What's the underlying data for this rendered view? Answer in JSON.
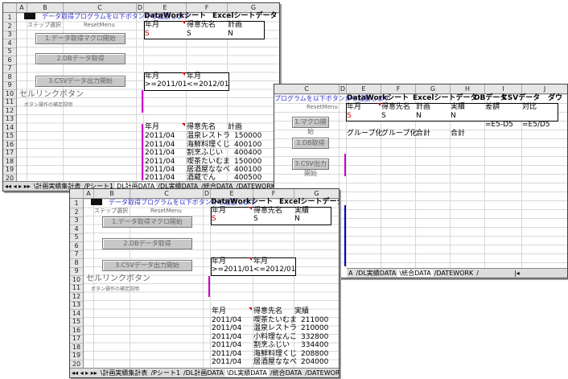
{
  "win1": {
    "cols": [
      "A",
      "B",
      "C",
      "D",
      "E",
      "F",
      "G"
    ],
    "rows": [
      "1",
      "2",
      "3",
      "4",
      "5",
      "6",
      "7",
      "8",
      "9",
      "10",
      "11",
      "12",
      "13",
      "14",
      "15",
      "16",
      "17",
      "18",
      "19",
      "20"
    ],
    "title_blue": "データ取得プログラムを以下ボタンから起動します",
    "sheet_label": "DataWorkシート",
    "sheet_label2": "Excelシートデータ",
    "subtitle_a": "ステップ選択",
    "subtitle_b": "ResetMenu",
    "btn1": "1.データ取得マクロ開始",
    "btn2": "2.DBデータ取得",
    "btn3": "3.CSVデータ出力開始",
    "cell_link": "セルリンクボタン",
    "cell_link_sub": "ボタン操作の補足説明",
    "hdr": [
      "年月",
      "得意先名",
      "計画"
    ],
    "row3": [
      "S",
      "S",
      "N"
    ],
    "cond_hdr": [
      "年月",
      "年月"
    ],
    "cond_val": [
      ">=2011/01",
      "<=2012/01"
    ],
    "data_hdr": [
      "年月",
      "得意先名",
      "計画"
    ],
    "data_rows": [
      [
        "2011/04",
        "温泉レストラ",
        "150000"
      ],
      [
        "2011/04",
        "海鮮料理くじ",
        "400100"
      ],
      [
        "2011/04",
        "割烹ふじい",
        "400400"
      ],
      [
        "2011/04",
        "喫茶たいむま",
        "150000"
      ],
      [
        "2011/04",
        "居酒屋ななべ",
        "400100"
      ],
      [
        "2011/04",
        "酒蔵でん",
        "400500"
      ]
    ],
    "tabs": [
      "◂◂ ◂ ▸ ▸▸",
      "\\計画実績集計表",
      "/Pシート1",
      "DL計画DATA",
      "/DL実績DATA",
      "/統合DATA",
      "/DATEWORK",
      "/"
    ]
  },
  "win2": {
    "cols": [
      "C",
      "D",
      "E",
      "F",
      "G",
      "H",
      "I",
      "J"
    ],
    "rows": [
      "12",
      "13",
      "14",
      "15",
      "16",
      "17",
      "18",
      "19",
      "20"
    ],
    "title_blue": "プログラムを以下ボタンから起動します",
    "subtitle_b": "ResetMenu",
    "sheet_label": "DataWorkシート",
    "sheet_label2": "Excelシートデータ",
    "sheet_label3": "DBデータ",
    "sheet_label4": "CSVデータ",
    "sheet_label5": "ダウ",
    "btn1": "1.マクロ開始",
    "btn2": "2.DB取得",
    "btn3": "3.CSV出力開始",
    "hdr": [
      "年月",
      "得意先名",
      "計画",
      "実績",
      "差額",
      "対比"
    ],
    "row3": [
      "S",
      "S",
      "N",
      "N"
    ],
    "row4": [
      "=E5-D5",
      "=E5/D5"
    ],
    "row5": [
      "グループ化",
      "グループ化",
      "合計",
      "合計"
    ],
    "tabs": [
      "A",
      "/DL実績DATA",
      "\\統合DATA",
      "/DATEWORK",
      "/",
      "|◂"
    ]
  },
  "win3": {
    "cols": [
      "A",
      "B",
      "C",
      "D",
      "E",
      "F",
      "G"
    ],
    "rows": [
      "1",
      "2",
      "3",
      "4",
      "5",
      "6",
      "7",
      "8",
      "9",
      "10",
      "11",
      "12",
      "13",
      "14",
      "15",
      "16",
      "17",
      "18",
      "19",
      "20"
    ],
    "title_blue": "データ取得プログラムを以下ボタンから起動します",
    "sheet_label": "DataWorkシート",
    "sheet_label2": "Excelシートデータ",
    "subtitle_a": "ステップ選択",
    "subtitle_b": "ResetMenu",
    "btn1": "1.データ取得マクロ開始",
    "btn2": "2.DBデータ取得",
    "btn3": "3.CSVデータ出力開始",
    "cell_link": "セルリンクボタン",
    "cell_link_sub": "ボタン操作の補足説明",
    "hdr": [
      "年月",
      "得意先名",
      "実績"
    ],
    "row3": [
      "S",
      "S",
      "N"
    ],
    "cond_hdr": [
      "年月",
      "年月"
    ],
    "cond_val": [
      ">=2011/01",
      "<=2012/01"
    ],
    "data_hdr": [
      "年月",
      "得意先名",
      "実績"
    ],
    "data_rows": [
      [
        "2011/04",
        "喫茶たいむま",
        "211000"
      ],
      [
        "2011/04",
        "温泉レストラ",
        "210000"
      ],
      [
        "2011/04",
        "小料理なんこ",
        "332800"
      ],
      [
        "2011/04",
        "割烹ふじい",
        "334400"
      ],
      [
        "2011/04",
        "海鮮料理くじ",
        "208800"
      ],
      [
        "2011/04",
        "居酒屋ななべ",
        "204000"
      ]
    ],
    "tabs": [
      "◂◂ ◂ ▸ ▸▸",
      "\\計画実績集計表",
      "/Pシート1",
      "/DL計画DATA",
      "\\DL実績DATA",
      "/統合DATA",
      "/DATEWORK",
      "/"
    ]
  }
}
